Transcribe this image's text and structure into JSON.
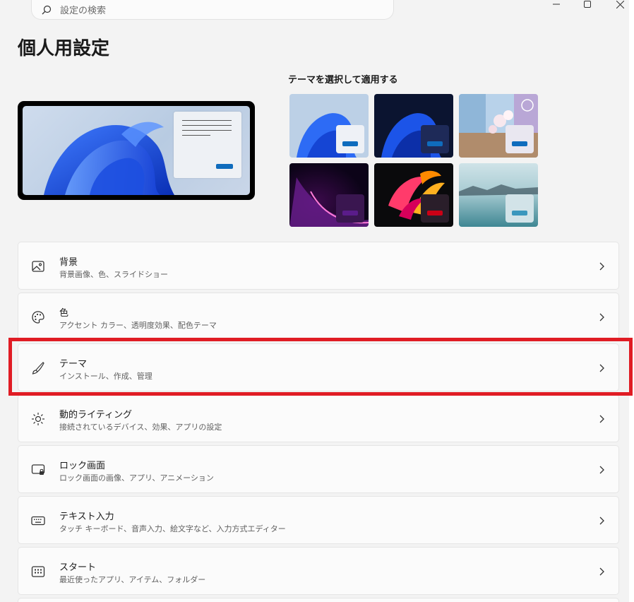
{
  "search": {
    "placeholder": "設定の検索",
    "icon": "search-icon"
  },
  "window_controls": [
    "minimize-icon",
    "maximize-icon",
    "close-icon"
  ],
  "page": {
    "title": "個人用設定"
  },
  "themes": {
    "label": "テーマを選択して適用する",
    "items": [
      {
        "name": "light",
        "accent": "#0f6cbd"
      },
      {
        "name": "dark",
        "accent": "#0f6cbd"
      },
      {
        "name": "flowers",
        "accent": "#0f6cbd"
      },
      {
        "name": "glow",
        "accent": "#5a1c8a"
      },
      {
        "name": "captured-motion",
        "accent": "#cc0016"
      },
      {
        "name": "sunrise",
        "accent": "#3b97bd"
      }
    ]
  },
  "settings": [
    {
      "title": "背景",
      "subtitle": "背景画像、色、スライドショー",
      "icon": "image-icon"
    },
    {
      "title": "色",
      "subtitle": "アクセント カラー、透明度効果、配色テーマ",
      "icon": "palette-icon"
    },
    {
      "title": "テーマ",
      "subtitle": "インストール、作成、管理",
      "icon": "brush-icon"
    },
    {
      "title": "動的ライティング",
      "subtitle": "接続されているデバイス、効果、アプリの設定",
      "icon": "lighting-icon"
    },
    {
      "title": "ロック画面",
      "subtitle": "ロック画面の画像、アプリ、アニメーション",
      "icon": "lock-screen-icon"
    },
    {
      "title": "テキスト入力",
      "subtitle": "タッチ キーボード、音声入力、絵文字など、入力方式エディター",
      "icon": "keyboard-icon"
    },
    {
      "title": "スタート",
      "subtitle": "最近使ったアプリ、アイテム、フォルダー",
      "icon": "start-icon"
    }
  ],
  "colors": {
    "highlight": "#e01c24",
    "accent": "#0f6cbd"
  }
}
